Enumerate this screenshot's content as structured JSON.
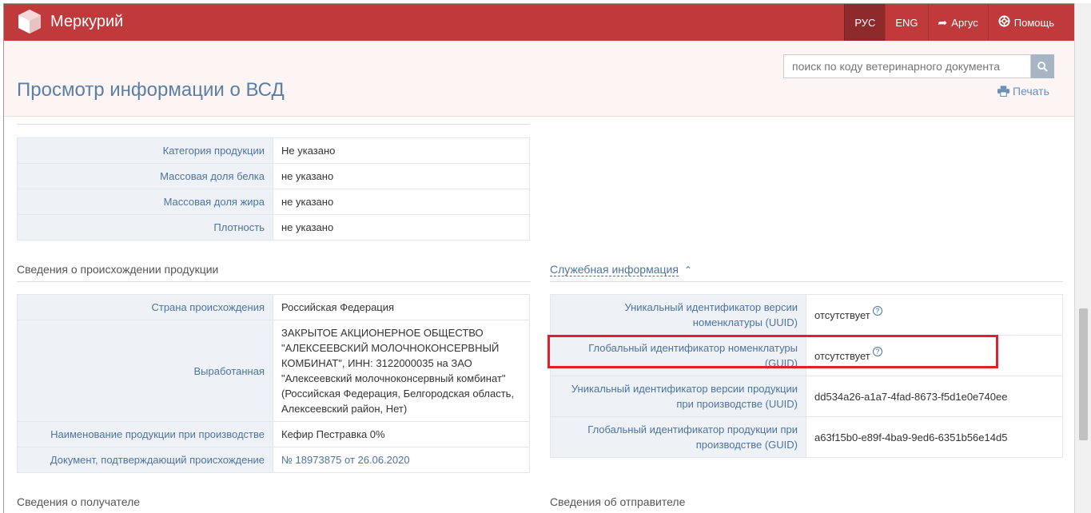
{
  "navbar": {
    "brand": "Меркурий",
    "lang_ru": "РУС",
    "lang_en": "ENG",
    "argus": "Аргус",
    "help": "Помощь"
  },
  "header": {
    "title": "Просмотр информации о ВСД",
    "search_placeholder": "поиск по коду ветеринарного документа",
    "print": "Печать"
  },
  "product_props": [
    {
      "key": "Категория продукции",
      "value": "Не указано"
    },
    {
      "key": "Массовая доля белка",
      "value": "не указано"
    },
    {
      "key": "Массовая доля жира",
      "value": "не указано"
    },
    {
      "key": "Плотность",
      "value": "не указано"
    }
  ],
  "origin": {
    "title": "Сведения о происхождении продукции",
    "rows": [
      {
        "key": "Страна происхождения",
        "value": "Российская Федерация"
      },
      {
        "key": "Выработанная",
        "value": "ЗАКРЫТОЕ АКЦИОНЕРНОЕ ОБЩЕСТВО \"АЛЕКСЕЕВСКИЙ МОЛОЧНОКОНСЕРВНЫЙ КОМБИНАТ\", ИНН: 3122000035 на ЗАО \"Алексеевский молочноконсервный комбинат\" (Российская Федерация, Белгородская область, Алексеевский район, Нет)"
      },
      {
        "key": "Наименование продукции при производстве",
        "value": "Кефир Пестравка 0%"
      },
      {
        "key": "Документ, подтверждающий происхождение",
        "value": "№ 18973875 от 26.06.2020"
      }
    ]
  },
  "service": {
    "title": "Служебная информация",
    "rows": [
      {
        "key": "Уникальный идентификатор версии номенклатуры (UUID)",
        "value": "отсутствует"
      },
      {
        "key": "Глобальный идентификатор номенклатуры (GUID)",
        "value": "отсутствует"
      },
      {
        "key": "Уникальный идентификатор версии продукции при производстве (UUID)",
        "value": "dd534a26-a1a7-4fad-8673-f5d1e0e740ee"
      },
      {
        "key": "Глобальный идентификатор продукции при производстве (GUID)",
        "value": "a63f15b0-e89f-4ba9-9ed6-6351b56e14d5"
      }
    ]
  },
  "recipient": {
    "title": "Сведения о получателе"
  },
  "sender": {
    "title": "Сведения об отправителе"
  },
  "colors": {
    "navbar": "#c0393b",
    "nav_active": "#8e2a2c",
    "link": "#4d73a0",
    "highlight": "#e0212b"
  }
}
